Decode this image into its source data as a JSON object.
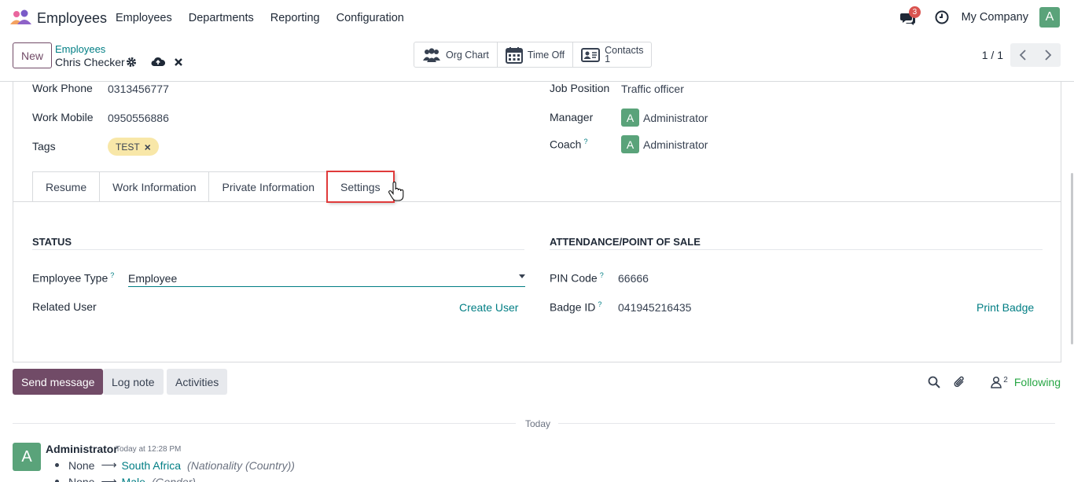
{
  "nav": {
    "app_name": "Employees",
    "menu": [
      "Employees",
      "Departments",
      "Reporting",
      "Configuration"
    ],
    "messages_count": "3",
    "company": "My Company",
    "user_initial": "A"
  },
  "control": {
    "new_label": "New",
    "breadcrumb_parent": "Employees",
    "breadcrumb_current": "Chris Checker",
    "smart_buttons": {
      "org_chart": "Org Chart",
      "time_off": "Time Off",
      "contacts_label": "Contacts",
      "contacts_count": "1"
    },
    "pager": "1 / 1"
  },
  "form": {
    "work_phone_label": "Work Phone",
    "work_phone": "0313456777",
    "work_mobile_label": "Work Mobile",
    "work_mobile": "0950556886",
    "tags_label": "Tags",
    "tag": "TEST",
    "job_position_label": "Job Position",
    "job_position": "Traffic officer",
    "manager_label": "Manager",
    "manager": "Administrator",
    "manager_initial": "A",
    "coach_label": "Coach",
    "coach": "Administrator",
    "coach_initial": "A",
    "help_mark": "?"
  },
  "tabs": [
    "Resume",
    "Work Information",
    "Private Information",
    "Settings"
  ],
  "settings": {
    "status_title": "STATUS",
    "employee_type_label": "Employee Type",
    "employee_type": "Employee",
    "related_user_label": "Related User",
    "create_user": "Create User",
    "attendance_title": "ATTENDANCE/POINT OF SALE",
    "pin_label": "PIN Code",
    "pin": "66666",
    "badge_label": "Badge ID",
    "badge": "041945216435",
    "print_badge": "Print Badge"
  },
  "chatter": {
    "send_message": "Send message",
    "log_note": "Log note",
    "activities": "Activities",
    "followers_count": "2",
    "following": "Following",
    "today": "Today",
    "author": "Administrator",
    "author_initial": "A",
    "time": "Today at 12:28 PM",
    "tracking": [
      {
        "old": "None",
        "new": "South Africa",
        "field": "(Nationality (Country))"
      },
      {
        "old": "None",
        "new": "Male",
        "field": "(Gender)"
      }
    ]
  },
  "colors": {
    "brand": "#714b67",
    "link": "#017e84",
    "avatar": "#5aa37a",
    "tag": "#f8e7a8",
    "highlight": "#e03b3b"
  }
}
